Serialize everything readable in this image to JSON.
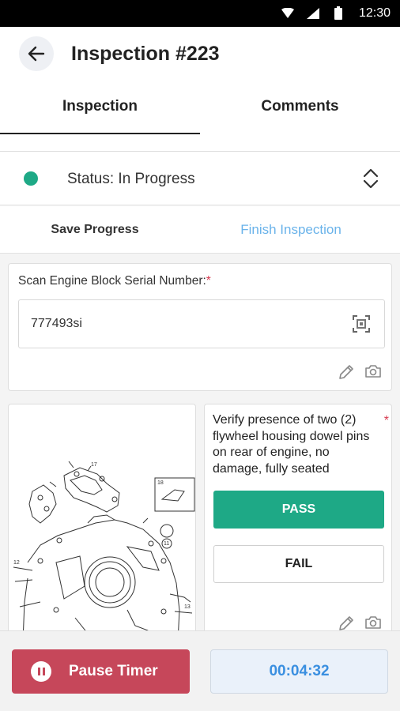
{
  "status_bar": {
    "time": "12:30"
  },
  "header": {
    "title": "Inspection #223"
  },
  "tabs": [
    {
      "label": "Inspection"
    },
    {
      "label": "Comments"
    }
  ],
  "status": {
    "text": "Status: In Progress",
    "color": "#1ea986"
  },
  "actions": {
    "save_label": "Save Progress",
    "finish_label": "Finish Inspection"
  },
  "scan_field": {
    "label": "Scan Engine Block Serial Number:",
    "required_mark": "*",
    "value": "777493si"
  },
  "check_item": {
    "text": "Verify presence of two (2) flywheel housing dowel pins on rear of engine, no damage, fully seated",
    "required_mark": "*",
    "pass_label": "PASS",
    "fail_label": "FAIL"
  },
  "diagram": {
    "callouts": [
      "17",
      "18",
      "11",
      "12",
      "13"
    ]
  },
  "footer": {
    "pause_label": "Pause Timer",
    "timer": "00:04:32"
  },
  "colors": {
    "accent": "#1ea986",
    "pause": "#c6475a",
    "link": "#6ab3ea",
    "timer": "#3a8fe0"
  }
}
